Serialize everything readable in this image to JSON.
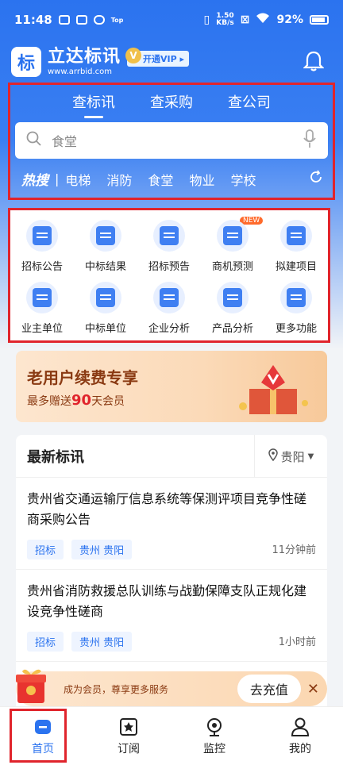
{
  "status": {
    "time": "11:48",
    "net_speed_top": "1.50",
    "net_speed_bottom": "KB/s",
    "battery": "92%",
    "tag": "Top"
  },
  "app": {
    "logo_char": "标",
    "name": "立达标讯",
    "url": "www.arrbid.com",
    "vip_label": "开通VIP ▸",
    "vip_badge": "V"
  },
  "search": {
    "tabs": [
      "查标讯",
      "查采购",
      "查公司"
    ],
    "placeholder": "食堂",
    "hot_label": "热搜",
    "hot_items": [
      "电梯",
      "消防",
      "食堂",
      "物业",
      "学校"
    ]
  },
  "grid": {
    "items": [
      {
        "label": "招标公告"
      },
      {
        "label": "中标结果"
      },
      {
        "label": "招标预告"
      },
      {
        "label": "商机预测"
      },
      {
        "label": "拟建项目"
      },
      {
        "label": "业主单位"
      },
      {
        "label": "中标单位"
      },
      {
        "label": "企业分析"
      },
      {
        "label": "产品分析"
      },
      {
        "label": "更多功能"
      }
    ],
    "new_badge": "NEW"
  },
  "promo": {
    "title": "老用户续费专享",
    "sub_prefix": "最多赠送",
    "sub_num": "90",
    "sub_suffix": "天会员"
  },
  "news": {
    "title": "最新标讯",
    "city": "贵阳",
    "items": [
      {
        "title": "贵州省交通运输厅信息系统等保测评项目竞争性磋商采购公告",
        "tag1": "招标",
        "tag2": "贵州 贵阳",
        "time": "11分钟前"
      },
      {
        "title": "贵州省消防救援总队训练与战勤保障支队正规化建设竞争性磋商",
        "tag1": "招标",
        "tag2": "贵州 贵阳",
        "time": "1小时前"
      }
    ]
  },
  "member": {
    "text": "成为会员，尊享更多服务",
    "button": "去充值"
  },
  "nav": {
    "items": [
      {
        "label": "首页"
      },
      {
        "label": "订阅"
      },
      {
        "label": "监控"
      },
      {
        "label": "我的"
      }
    ]
  },
  "colors": {
    "brand": "#2b73ef",
    "highlight_box": "#e0242c"
  }
}
